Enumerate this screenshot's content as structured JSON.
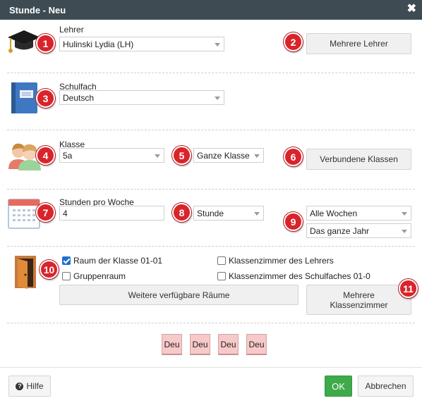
{
  "window": {
    "title": "Stunde - Neu",
    "close_icon": "close-icon"
  },
  "teacher": {
    "label": "Lehrer",
    "value": "Hulinski Lydia (LH)",
    "badge": "1",
    "button_label": "Mehrere Lehrer",
    "button_badge": "2"
  },
  "subject": {
    "label": "Schulfach",
    "value": "Deutsch",
    "badge": "3"
  },
  "klasse": {
    "label": "Klasse",
    "value": "5a",
    "badge": "4",
    "group_value": "Ganze Klasse",
    "group_badge": "5",
    "button_label": "Verbundene Klassen",
    "button_badge": "6"
  },
  "hours": {
    "label": "Stunden pro Woche",
    "value": "4",
    "badge": "7",
    "unit_value": "Stunde",
    "unit_badge": "8",
    "weeks_value": "Alle Wochen",
    "period_value": "Das ganze Jahr",
    "weeks_badge": "9"
  },
  "rooms": {
    "badge": "10",
    "options": [
      {
        "label": "Raum der Klasse 01-01",
        "checked": true
      },
      {
        "label": "Klassenzimmer des Lehrers",
        "checked": false
      },
      {
        "label": "Gruppenraum",
        "checked": false
      },
      {
        "label": "Klassenzimmer des Schulfaches 01-0",
        "checked": false
      }
    ],
    "more_rooms_button": "Weitere verfügbare Räume",
    "multi_rooms_button_line1": "Mehrere",
    "multi_rooms_button_line2": "Klassenzimmer",
    "multi_rooms_badge": "11"
  },
  "lessons": [
    "Deu",
    "Deu",
    "Deu",
    "Deu"
  ],
  "footer": {
    "help_label": "Hilfe",
    "ok_label": "OK",
    "cancel_label": "Abbrechen"
  },
  "colors": {
    "titlebar": "#3e4b53",
    "badge": "#d8242a",
    "ok": "#3eaa4a",
    "chip": "#f7c9c9"
  }
}
